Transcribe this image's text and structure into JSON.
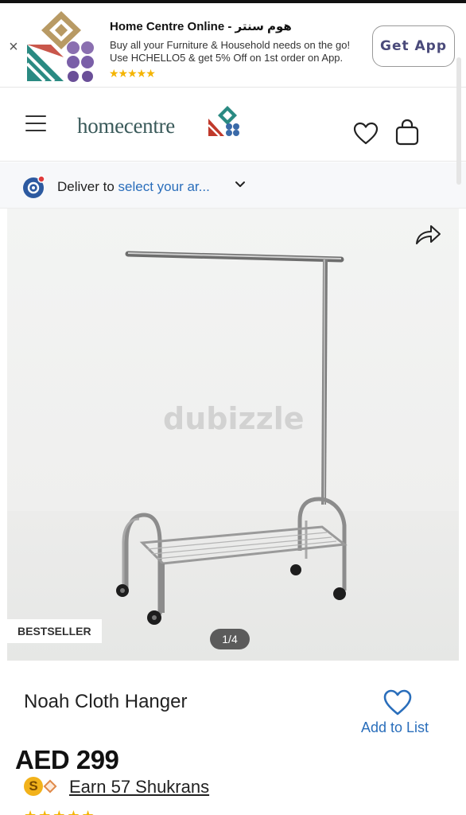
{
  "banner": {
    "close_glyph": "×",
    "title": "Home Centre Online - هوم سنتر",
    "description_line1": "Buy all your Furniture & Household needs on the go!",
    "description_line2": "Use HCHELLO5 & get 5% Off on 1st order on App.",
    "stars": "★★★★★",
    "cta_label": "Get App"
  },
  "header": {
    "brand_name": "homecentre",
    "icons": [
      "menu-icon",
      "heart-icon",
      "bag-icon"
    ]
  },
  "delivery": {
    "prefix": "Deliver to",
    "location_placeholder": "select your ar...",
    "icons": [
      "location-pin-icon",
      "chevron-down-icon"
    ]
  },
  "product_image": {
    "watermark": "dubizzle",
    "badge": "BESTSELLER",
    "counter": "1/4",
    "icons": [
      "share-icon"
    ]
  },
  "product": {
    "name": "Noah Cloth Hanger",
    "add_to_list_label": "Add to List",
    "price": "AED 299",
    "shukran_coin": "S",
    "shukran_text": "Earn 57 Shukrans",
    "rating_stars": "★★★★★"
  },
  "colors": {
    "link_blue": "#2a6ebb",
    "star_gold": "#f4b400",
    "brand_teal": "#3a5a5a"
  }
}
